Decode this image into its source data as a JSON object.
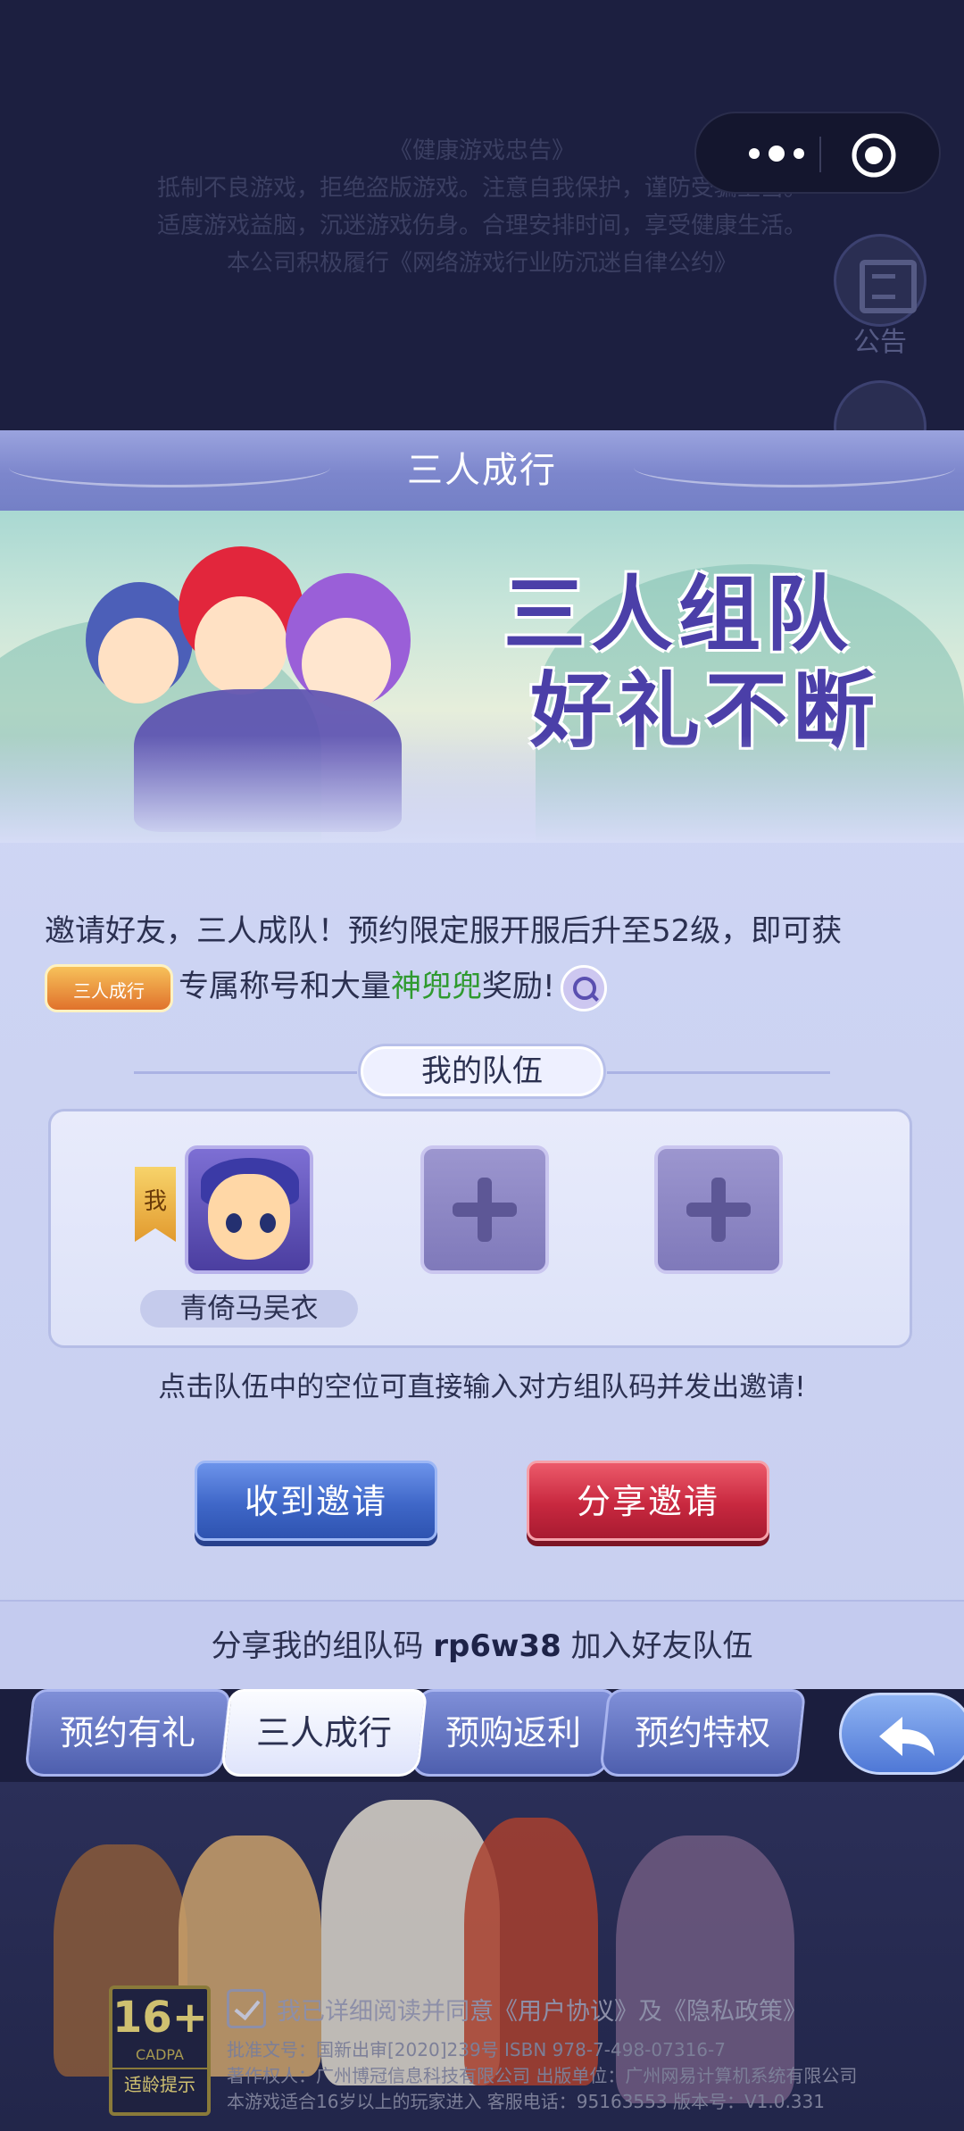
{
  "top": {
    "notice_lines": [
      "《健康游戏忠告》",
      "抵制不良游戏，拒绝盗版游戏。注意自我保护，谨防受骗上当。",
      "适度游戏益脑，沉迷游戏伤身。合理安排时间，享受健康生活。",
      "本公司积极履行《网络游戏行业防沉迷自律公约》"
    ],
    "announcement_label": "公告"
  },
  "panel": {
    "title": "三人成行",
    "banner_slogan_line1": "三人组队",
    "banner_slogan_line2": "好礼不断",
    "desc_line1": "邀请好友，三人成队！预约限定服开服后升至52级，即可获",
    "desc_badge": "三人成行",
    "desc_part1": "专属称号和大量",
    "desc_highlight": "神兜兜",
    "desc_part2": "奖励!",
    "my_team_label": "我的队伍",
    "member_tag": "我",
    "member_name": "青倚马吴衣",
    "tip": "点击队伍中的空位可直接输入对方组队码并发出邀请!",
    "receive_button": "收到邀请",
    "share_button": "分享邀请",
    "code_prefix": "分享我的组队码",
    "code_value": "rp6w38",
    "code_suffix": "加入好友队伍"
  },
  "tabs": [
    "预约有礼",
    "三人成行",
    "预购返利",
    "预约特权"
  ],
  "active_tab": "三人成行",
  "footer": {
    "age_number": "16+",
    "age_org": "CADPA",
    "age_hint": "适龄提示",
    "agree_prefix": "我已详细阅读并同意",
    "agree_user": "《用户协议》",
    "agree_and": "及",
    "agree_privacy": "《隐私政策》",
    "legal_line1": "批准文号：国新出审[2020]239号  ISBN 978-7-498-07316-7",
    "legal_line2": "著作权人：广州博冠信息科技有限公司 出版单位：广州网易计算机系统有限公司",
    "legal_line3": "本游戏适合16岁以上的玩家进入 客服电话：95163553 版本号：V1.0.331"
  },
  "colors": {
    "panel_bg": "#d6dcf6",
    "title_bar": "#7c86cc",
    "receive_btn": "#3f67c8",
    "share_btn": "#c8283f",
    "highlight_green": "#2f9a2f"
  },
  "icons": [
    "more-dots-icon",
    "record-target-icon",
    "announcement-icon",
    "wrench-icon",
    "magnifier-icon",
    "plus-icon",
    "back-arrow-icon",
    "checkbox-check-icon"
  ]
}
